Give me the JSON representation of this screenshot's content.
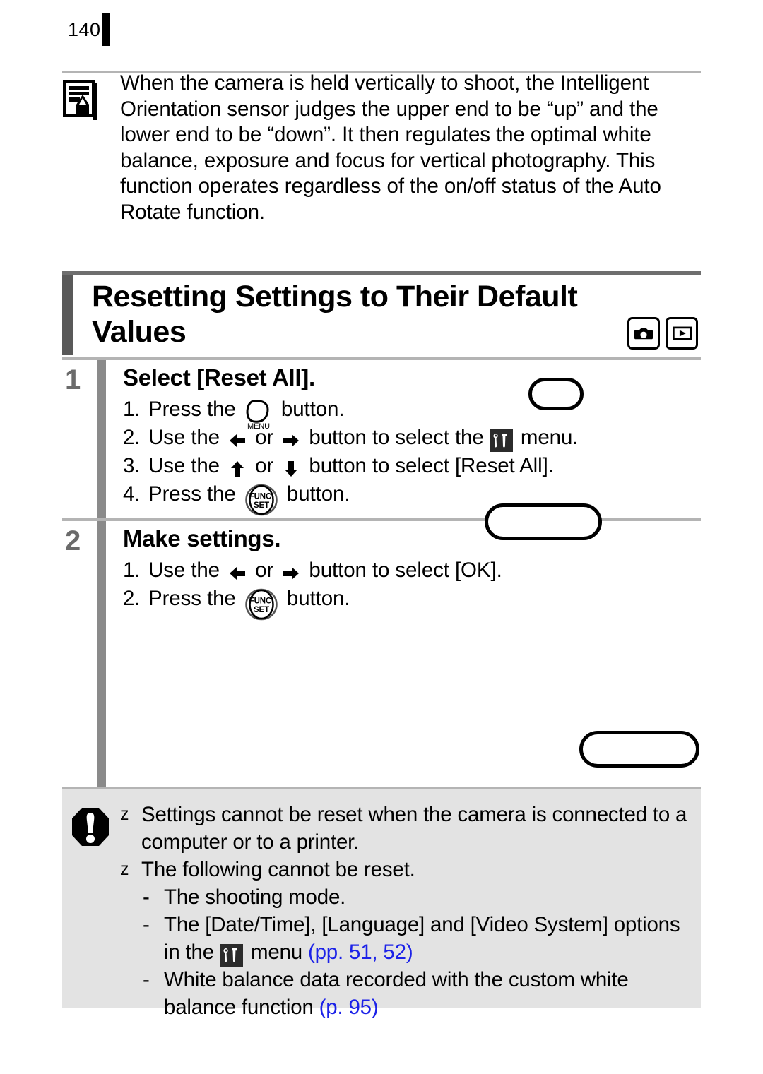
{
  "page": {
    "number": "140"
  },
  "note": {
    "icon": "memo-pencil-icon",
    "text": "When the camera is held vertically to shoot, the Intelligent Orientation sensor judges the upper end to be “up” and the lower end to be “down”. It then regulates the optimal white balance, exposure and focus for vertical photography. This function operates regardless of the on/off status of the Auto Rotate function."
  },
  "heading": {
    "title": "Resetting Settings to Their Default Values",
    "mode_icons": [
      "shooting-mode-camera-icon",
      "playback-mode-icon"
    ]
  },
  "steps": [
    {
      "number": "1",
      "title": "Select [Reset All].",
      "items": [
        {
          "marker": "1.",
          "parts": [
            {
              "type": "text",
              "value": "Press the "
            },
            {
              "type": "icon",
              "value": "menu-button-icon"
            },
            {
              "type": "text",
              "value": " button."
            }
          ]
        },
        {
          "marker": "2.",
          "parts": [
            {
              "type": "text",
              "value": "Use the "
            },
            {
              "type": "icon",
              "value": "arrow-left-icon"
            },
            {
              "type": "text",
              "value": " or "
            },
            {
              "type": "icon",
              "value": "arrow-right-icon"
            },
            {
              "type": "text",
              "value": " button to select the "
            },
            {
              "type": "icon",
              "value": "settings-tools-menu-icon"
            },
            {
              "type": "text",
              "value": " menu."
            }
          ]
        },
        {
          "marker": "3.",
          "parts": [
            {
              "type": "text",
              "value": "Use the "
            },
            {
              "type": "icon",
              "value": "arrow-up-icon"
            },
            {
              "type": "text",
              "value": " or "
            },
            {
              "type": "icon",
              "value": "arrow-down-icon"
            },
            {
              "type": "text",
              "value": " button to select [Reset All]."
            }
          ]
        },
        {
          "marker": "4.",
          "parts": [
            {
              "type": "text",
              "value": "Press the "
            },
            {
              "type": "icon",
              "value": "func-set-button-icon"
            },
            {
              "type": "text",
              "value": " button."
            }
          ]
        }
      ]
    },
    {
      "number": "2",
      "title": "Make settings.",
      "items": [
        {
          "marker": "1.",
          "parts": [
            {
              "type": "text",
              "value": "Use the "
            },
            {
              "type": "icon",
              "value": "arrow-left-icon"
            },
            {
              "type": "text",
              "value": " or "
            },
            {
              "type": "icon",
              "value": "arrow-right-icon"
            },
            {
              "type": "text",
              "value": " button to select [OK]."
            }
          ]
        },
        {
          "marker": "2.",
          "parts": [
            {
              "type": "text",
              "value": "Press the "
            },
            {
              "type": "icon",
              "value": "func-set-button-icon"
            },
            {
              "type": "text",
              "value": " button."
            }
          ]
        }
      ]
    }
  ],
  "lcd_placeholders": [
    {
      "name": "lcd-screenshot-placeholder-1"
    },
    {
      "name": "lcd-screenshot-placeholder-2"
    },
    {
      "name": "lcd-screenshot-placeholder-3"
    }
  ],
  "caution": {
    "icon": "caution-exclamation-icon",
    "bullet_char": "z",
    "dash_char": "-",
    "lines": [
      {
        "kind": "bullet",
        "parts": [
          {
            "type": "text",
            "value": "Settings cannot be reset when the camera is connected to a computer or to a printer."
          }
        ]
      },
      {
        "kind": "bullet",
        "parts": [
          {
            "type": "text",
            "value": "The following cannot be reset."
          }
        ]
      },
      {
        "kind": "dash",
        "parts": [
          {
            "type": "text",
            "value": "The shooting mode."
          }
        ]
      },
      {
        "kind": "dash",
        "parts": [
          {
            "type": "text",
            "value": "The [Date/Time], [Language] and [Video System] options in the "
          },
          {
            "type": "icon",
            "value": "settings-tools-menu-icon"
          },
          {
            "type": "text",
            "value": " menu "
          },
          {
            "type": "pageref",
            "value": "(pp. 51, 52)"
          }
        ]
      },
      {
        "kind": "dash",
        "parts": [
          {
            "type": "text",
            "value": "White balance data recorded with the custom white balance function "
          },
          {
            "type": "pageref",
            "value": "(p. 95)"
          }
        ]
      }
    ]
  },
  "colors": {
    "page_reference_link": "#1c22e8",
    "caution_background": "#e3e3e3",
    "rule_gray": "#b4b4b4",
    "step_number_gray": "#6b6b6b",
    "step_bar_gray": "#8a8a8a"
  }
}
